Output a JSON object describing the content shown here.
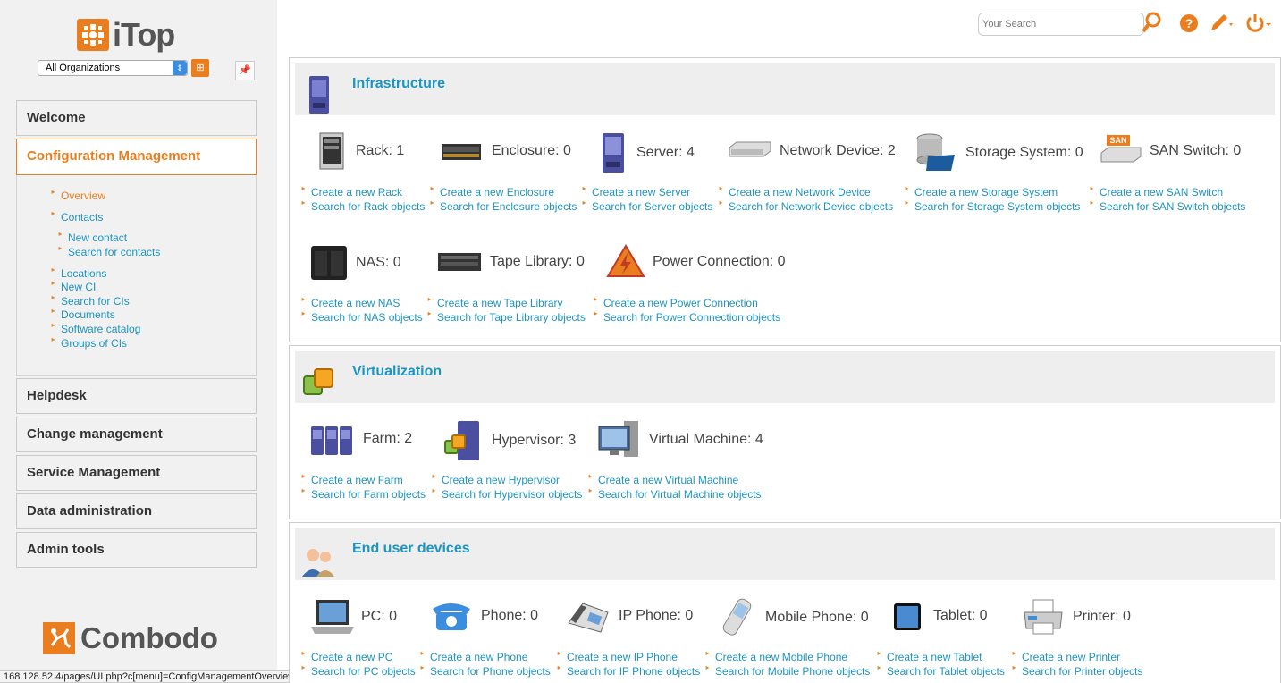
{
  "app": {
    "name": "iTop",
    "footer_logo": "Combodo"
  },
  "org_selector": {
    "value": "All Organizations"
  },
  "search": {
    "placeholder": "Your Search"
  },
  "status_url": "168.128.52.4/pages/UI.php?c[menu]=ConfigManagementOverview",
  "menu": {
    "groups": [
      {
        "label": "Welcome"
      },
      {
        "label": "Configuration Management"
      },
      {
        "label": "Helpdesk"
      },
      {
        "label": "Change management"
      },
      {
        "label": "Service Management"
      },
      {
        "label": "Data administration"
      },
      {
        "label": "Admin tools"
      }
    ],
    "sub": [
      "Overview",
      "Contacts",
      "New contact",
      "Search for contacts",
      "Locations",
      "New CI",
      "Search for CIs",
      "Documents",
      "Software catalog",
      "Groups of CIs"
    ]
  },
  "sections": [
    {
      "title": "Infrastructure",
      "items": [
        {
          "label": "Rack: 1",
          "create": "Create a new Rack",
          "search": "Search for Rack objects"
        },
        {
          "label": "Enclosure: 0",
          "create": "Create a new Enclosure",
          "search": "Search for Enclosure objects"
        },
        {
          "label": "Server: 4",
          "create": "Create a new Server",
          "search": "Search for Server objects"
        },
        {
          "label": "Network Device: 2",
          "create": "Create a new Network Device",
          "search": "Search for Network Device objects"
        },
        {
          "label": "Storage System: 0",
          "create": "Create a new Storage System",
          "search": "Search for Storage System objects"
        },
        {
          "label": "SAN Switch: 0",
          "create": "Create a new SAN Switch",
          "search": "Search for SAN Switch objects"
        },
        {
          "label": "NAS: 0",
          "create": "Create a new NAS",
          "search": "Search for NAS objects"
        },
        {
          "label": "Tape Library: 0",
          "create": "Create a new Tape Library",
          "search": "Search for Tape Library objects"
        },
        {
          "label": "Power Connection: 0",
          "create": "Create a new Power Connection",
          "search": "Search for Power Connection objects"
        }
      ]
    },
    {
      "title": "Virtualization",
      "items": [
        {
          "label": "Farm: 2",
          "create": "Create a new Farm",
          "search": "Search for Farm objects"
        },
        {
          "label": "Hypervisor: 3",
          "create": "Create a new Hypervisor",
          "search": "Search for Hypervisor objects"
        },
        {
          "label": "Virtual Machine: 4",
          "create": "Create a new Virtual Machine",
          "search": "Search for Virtual Machine objects"
        }
      ]
    },
    {
      "title": "End user devices",
      "items": [
        {
          "label": "PC: 0",
          "create": "Create a new PC",
          "search": "Search for PC objects"
        },
        {
          "label": "Phone: 0",
          "create": "Create a new Phone",
          "search": "Search for Phone objects"
        },
        {
          "label": "IP Phone: 0",
          "create": "Create a new IP Phone",
          "search": "Search for IP Phone objects"
        },
        {
          "label": "Mobile Phone: 0",
          "create": "Create a new Mobile Phone",
          "search": "Search for Mobile Phone objects"
        },
        {
          "label": "Tablet: 0",
          "create": "Create a new Tablet",
          "search": "Search for Tablet objects"
        },
        {
          "label": "Printer: 0",
          "create": "Create a new Printer",
          "search": "Search for Printer objects"
        }
      ]
    }
  ]
}
